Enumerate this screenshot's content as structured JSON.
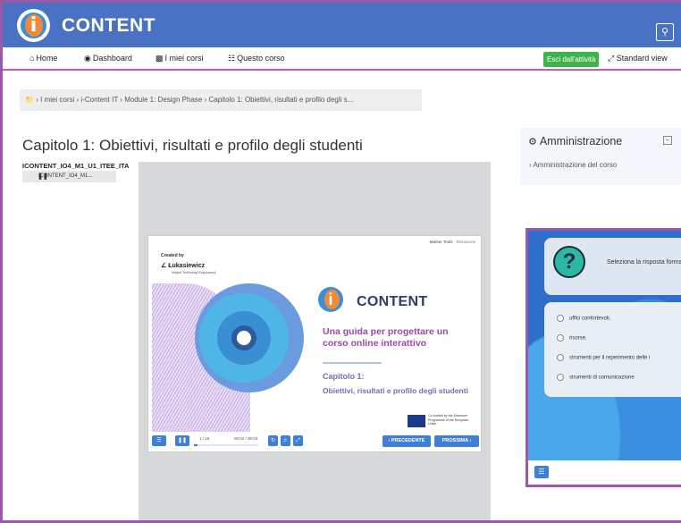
{
  "header": {
    "logo_text": "CONTENT",
    "logo_glyph": "i",
    "search_icon": "search-icon"
  },
  "nav": {
    "home": "Home",
    "dashboard": "Dashboard",
    "my_courses": "I miei corsi",
    "this_course": "Questo corso",
    "exit_activity": "Esci dall'attività",
    "standard_view": "Standard view"
  },
  "breadcrumb": {
    "items": [
      "I miei corsi",
      "i-Content IT",
      "Module 1: Design Phase",
      "Capitolo 1: Obiettivi, risultati e profilo degli s..."
    ]
  },
  "main": {
    "page_title": "Capitolo 1: Obiettivi, risultati e profilo degli studenti",
    "resource_code": "ICONTENT_IO4_M1_U1_ITEE_ITA",
    "file_chip": "ICONTENT_IO4_M1..."
  },
  "slide": {
    "top_links": [
      "Marker Tools",
      "Resources"
    ],
    "created_by": "Created by",
    "org_name": "Łukasiewicz",
    "org_sub": "Instytut Technologii Eksploatacji",
    "logo_text": "CONTENT",
    "title": "Una guida per progettare un corso online interattivo",
    "chapter": "Capitolo 1:",
    "subtitle": "Obiettivi, risultati e profilo degli studenti",
    "eu_text": "Co-funded by the Erasmus+ Programme of the European Union",
    "progress_label": "1 / 19",
    "progress_fraction": 0.05,
    "time": "00:02 / 00:03",
    "prev": "‹ PRECEDENTE",
    "next": "PROSSIMA ›"
  },
  "admin": {
    "title": "Amministrazione",
    "link": "Amministrazione del corso"
  },
  "quiz": {
    "question": "Seleziona la risposta formazione professio",
    "options": [
      "uffici confortevoli,",
      "risorse,",
      "strumenti per il reperimento delle i",
      "strumenti di comunicazione"
    ]
  },
  "colors": {
    "header_bg": "#4a72c2",
    "accent_purple": "#9b59a8",
    "button_blue": "#3d7fd9",
    "exit_green": "#3fb34b"
  }
}
